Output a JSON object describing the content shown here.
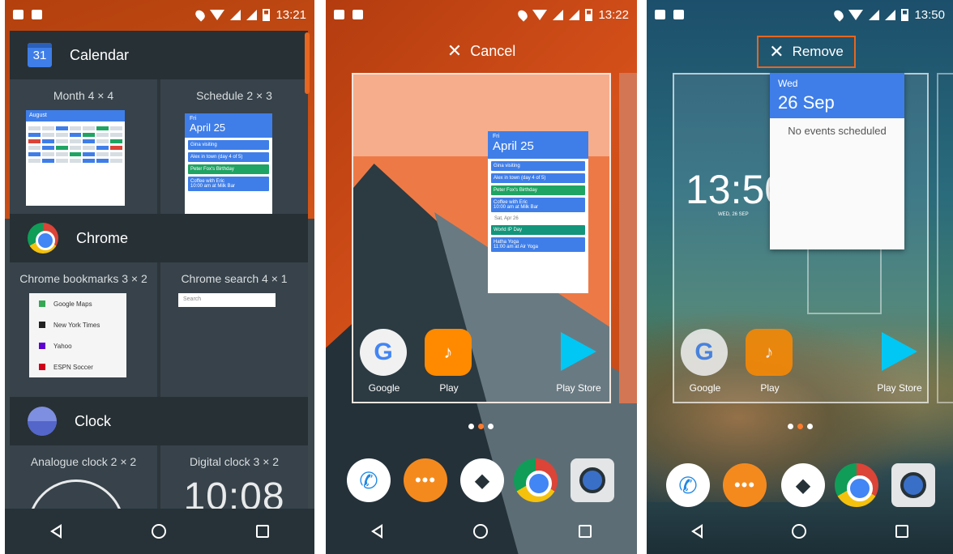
{
  "panel1": {
    "time": "13:21",
    "apps": [
      {
        "name": "Calendar",
        "icon_text": "31",
        "widgets": [
          {
            "label": "Month 4 × 4"
          },
          {
            "label": "Schedule 2 × 3"
          }
        ]
      },
      {
        "name": "Chrome",
        "widgets": [
          {
            "label": "Chrome bookmarks 3 × 2"
          },
          {
            "label": "Chrome search 4 × 1"
          }
        ]
      },
      {
        "name": "Clock",
        "widgets": [
          {
            "label": "Analogue clock 2 × 2"
          },
          {
            "label": "Digital clock 3 × 2"
          }
        ]
      }
    ],
    "month_preview": {
      "month": "August"
    },
    "schedule_preview": {
      "day": "Fri",
      "date": "April 25",
      "events": [
        "Gina visiting",
        "Alex in town (day 4 of 5)",
        "Peter Fox's Birthday",
        "Coffee with Eric",
        "10:00 am at Milk Bar"
      ]
    },
    "bookmarks": [
      "Google Maps",
      "New York Times",
      "Yahoo",
      "ESPN Soccer"
    ],
    "search_placeholder": "Search",
    "digital_clock": "10:08"
  },
  "panel2": {
    "time": "13:22",
    "cancel_label": "Cancel",
    "widget": {
      "day": "Fri",
      "date": "April 25",
      "events": [
        "Gina visiting",
        "Alex in town (day 4 of 5)",
        "Peter Fox's Birthday",
        "Coffee with Eric",
        "10:00 am at Milk Bar",
        "Sat, Apr 26",
        "World IP Day",
        "Hatha Yoga",
        "11:00 am at Air Yoga"
      ]
    },
    "apps": [
      "Google",
      "Play",
      "Play Store"
    ]
  },
  "panel3": {
    "time": "13:50",
    "remove_label": "Remove",
    "widget": {
      "day": "Wed",
      "date": "26 Sep",
      "empty": "No events scheduled"
    },
    "clock": "13:50",
    "clock_date": "WED, 26 SEP",
    "apps": [
      "Google",
      "Play",
      "Play Store"
    ]
  },
  "colors": {
    "accent": "#e8661f",
    "calendar_blue": "#3f7ee8",
    "event_green": "#1fa463"
  }
}
